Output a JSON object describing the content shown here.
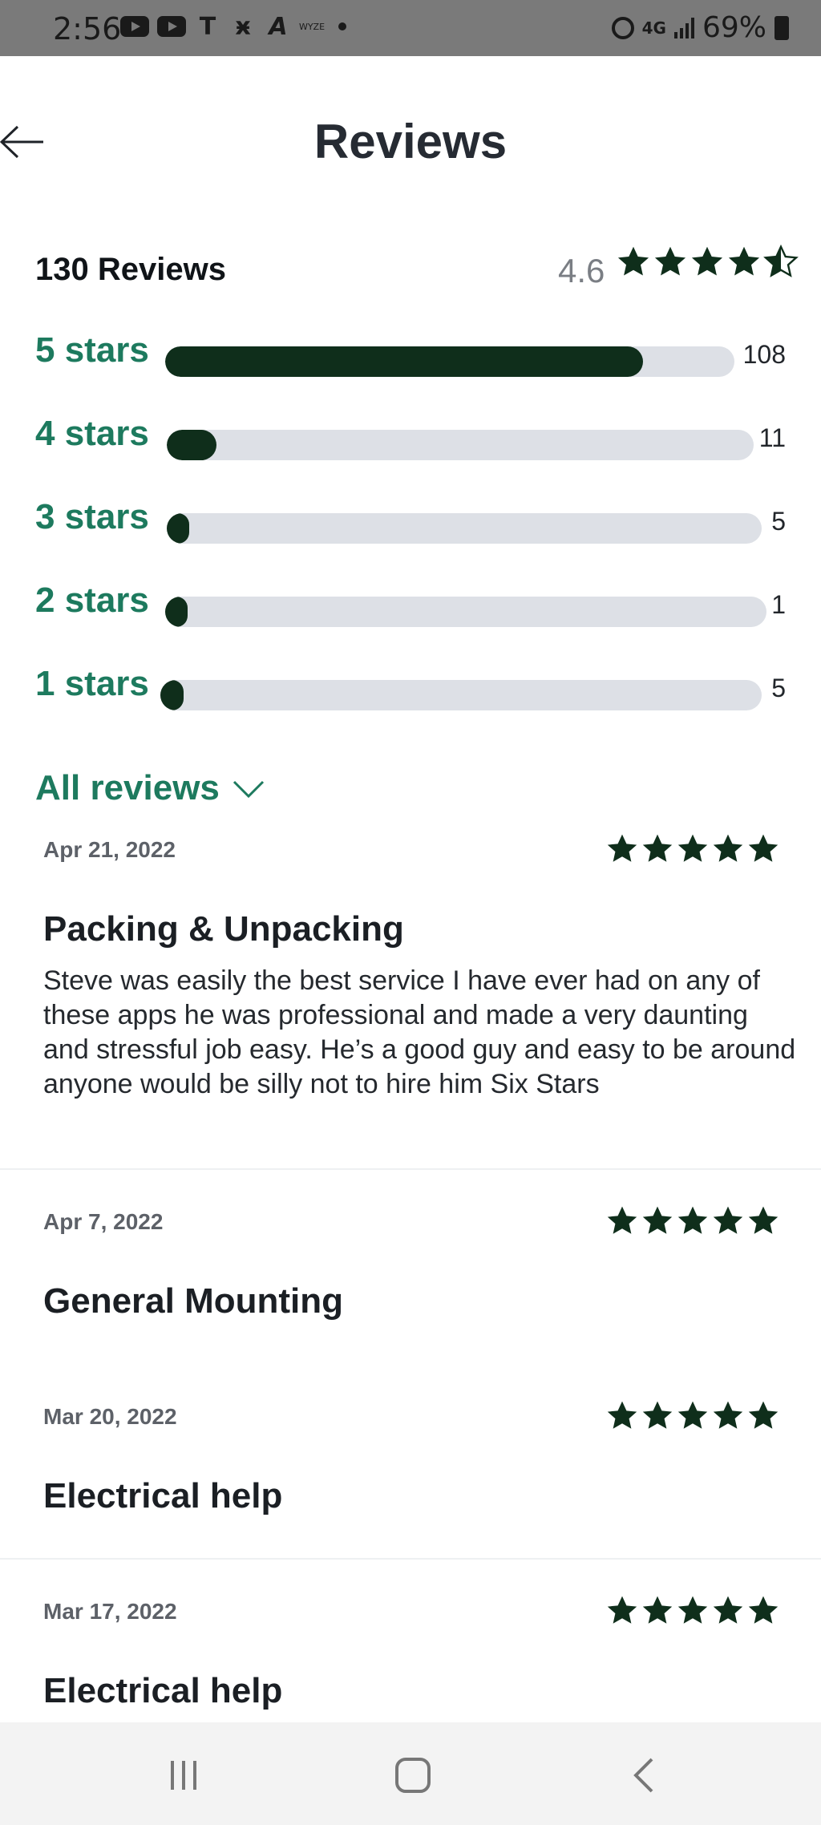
{
  "status_bar": {
    "time": "2:56",
    "left_icons": [
      "youtube-icon",
      "youtube-icon",
      "t-app-icon",
      "x-app-icon",
      "a-app-icon",
      "wyze-icon",
      "dot-icon"
    ],
    "wyze_text": "WYZE",
    "network": "4G",
    "battery": "69%"
  },
  "header": {
    "title": "Reviews",
    "back_icon": "arrow-left-icon"
  },
  "summary": {
    "count_label": "130 Reviews",
    "average": "4.6",
    "average_value": 4.6,
    "distribution": [
      {
        "label": "5 stars",
        "count": "108",
        "fraction": 0.84
      },
      {
        "label": "4 stars",
        "count": "11",
        "fraction": 0.085
      },
      {
        "label": "3 stars",
        "count": "5",
        "fraction": 0.038
      },
      {
        "label": "2 stars",
        "count": "1",
        "fraction": 0.012
      },
      {
        "label": "1 stars",
        "count": "5",
        "fraction": 0.038
      }
    ]
  },
  "filter": {
    "label": "All reviews",
    "icon": "chevron-down-icon"
  },
  "reviews": [
    {
      "date": "Apr 21, 2022",
      "rating": 5,
      "title": "Packing & Unpacking",
      "body": "Steve was easily the best service I have ever had on any of these apps he was professional and made a very daunting and stressful job easy. He’s a good guy and easy to be around anyone would be silly not to hire him Six Stars"
    },
    {
      "date": "Apr 7, 2022",
      "rating": 5,
      "title": "General Mounting",
      "body": ""
    },
    {
      "date": "Mar 20, 2022",
      "rating": 5,
      "title": "Electrical help",
      "body": ""
    },
    {
      "date": "Mar 17, 2022",
      "rating": 5,
      "title": "Electrical help",
      "body": ""
    }
  ],
  "nav_bar": {
    "icons": [
      "recent-apps-icon",
      "home-icon",
      "back-icon"
    ]
  },
  "colors": {
    "accent_green": "#1d7a5e",
    "star_dark": "#0f2e1b",
    "track_gray": "#dde0e6"
  }
}
